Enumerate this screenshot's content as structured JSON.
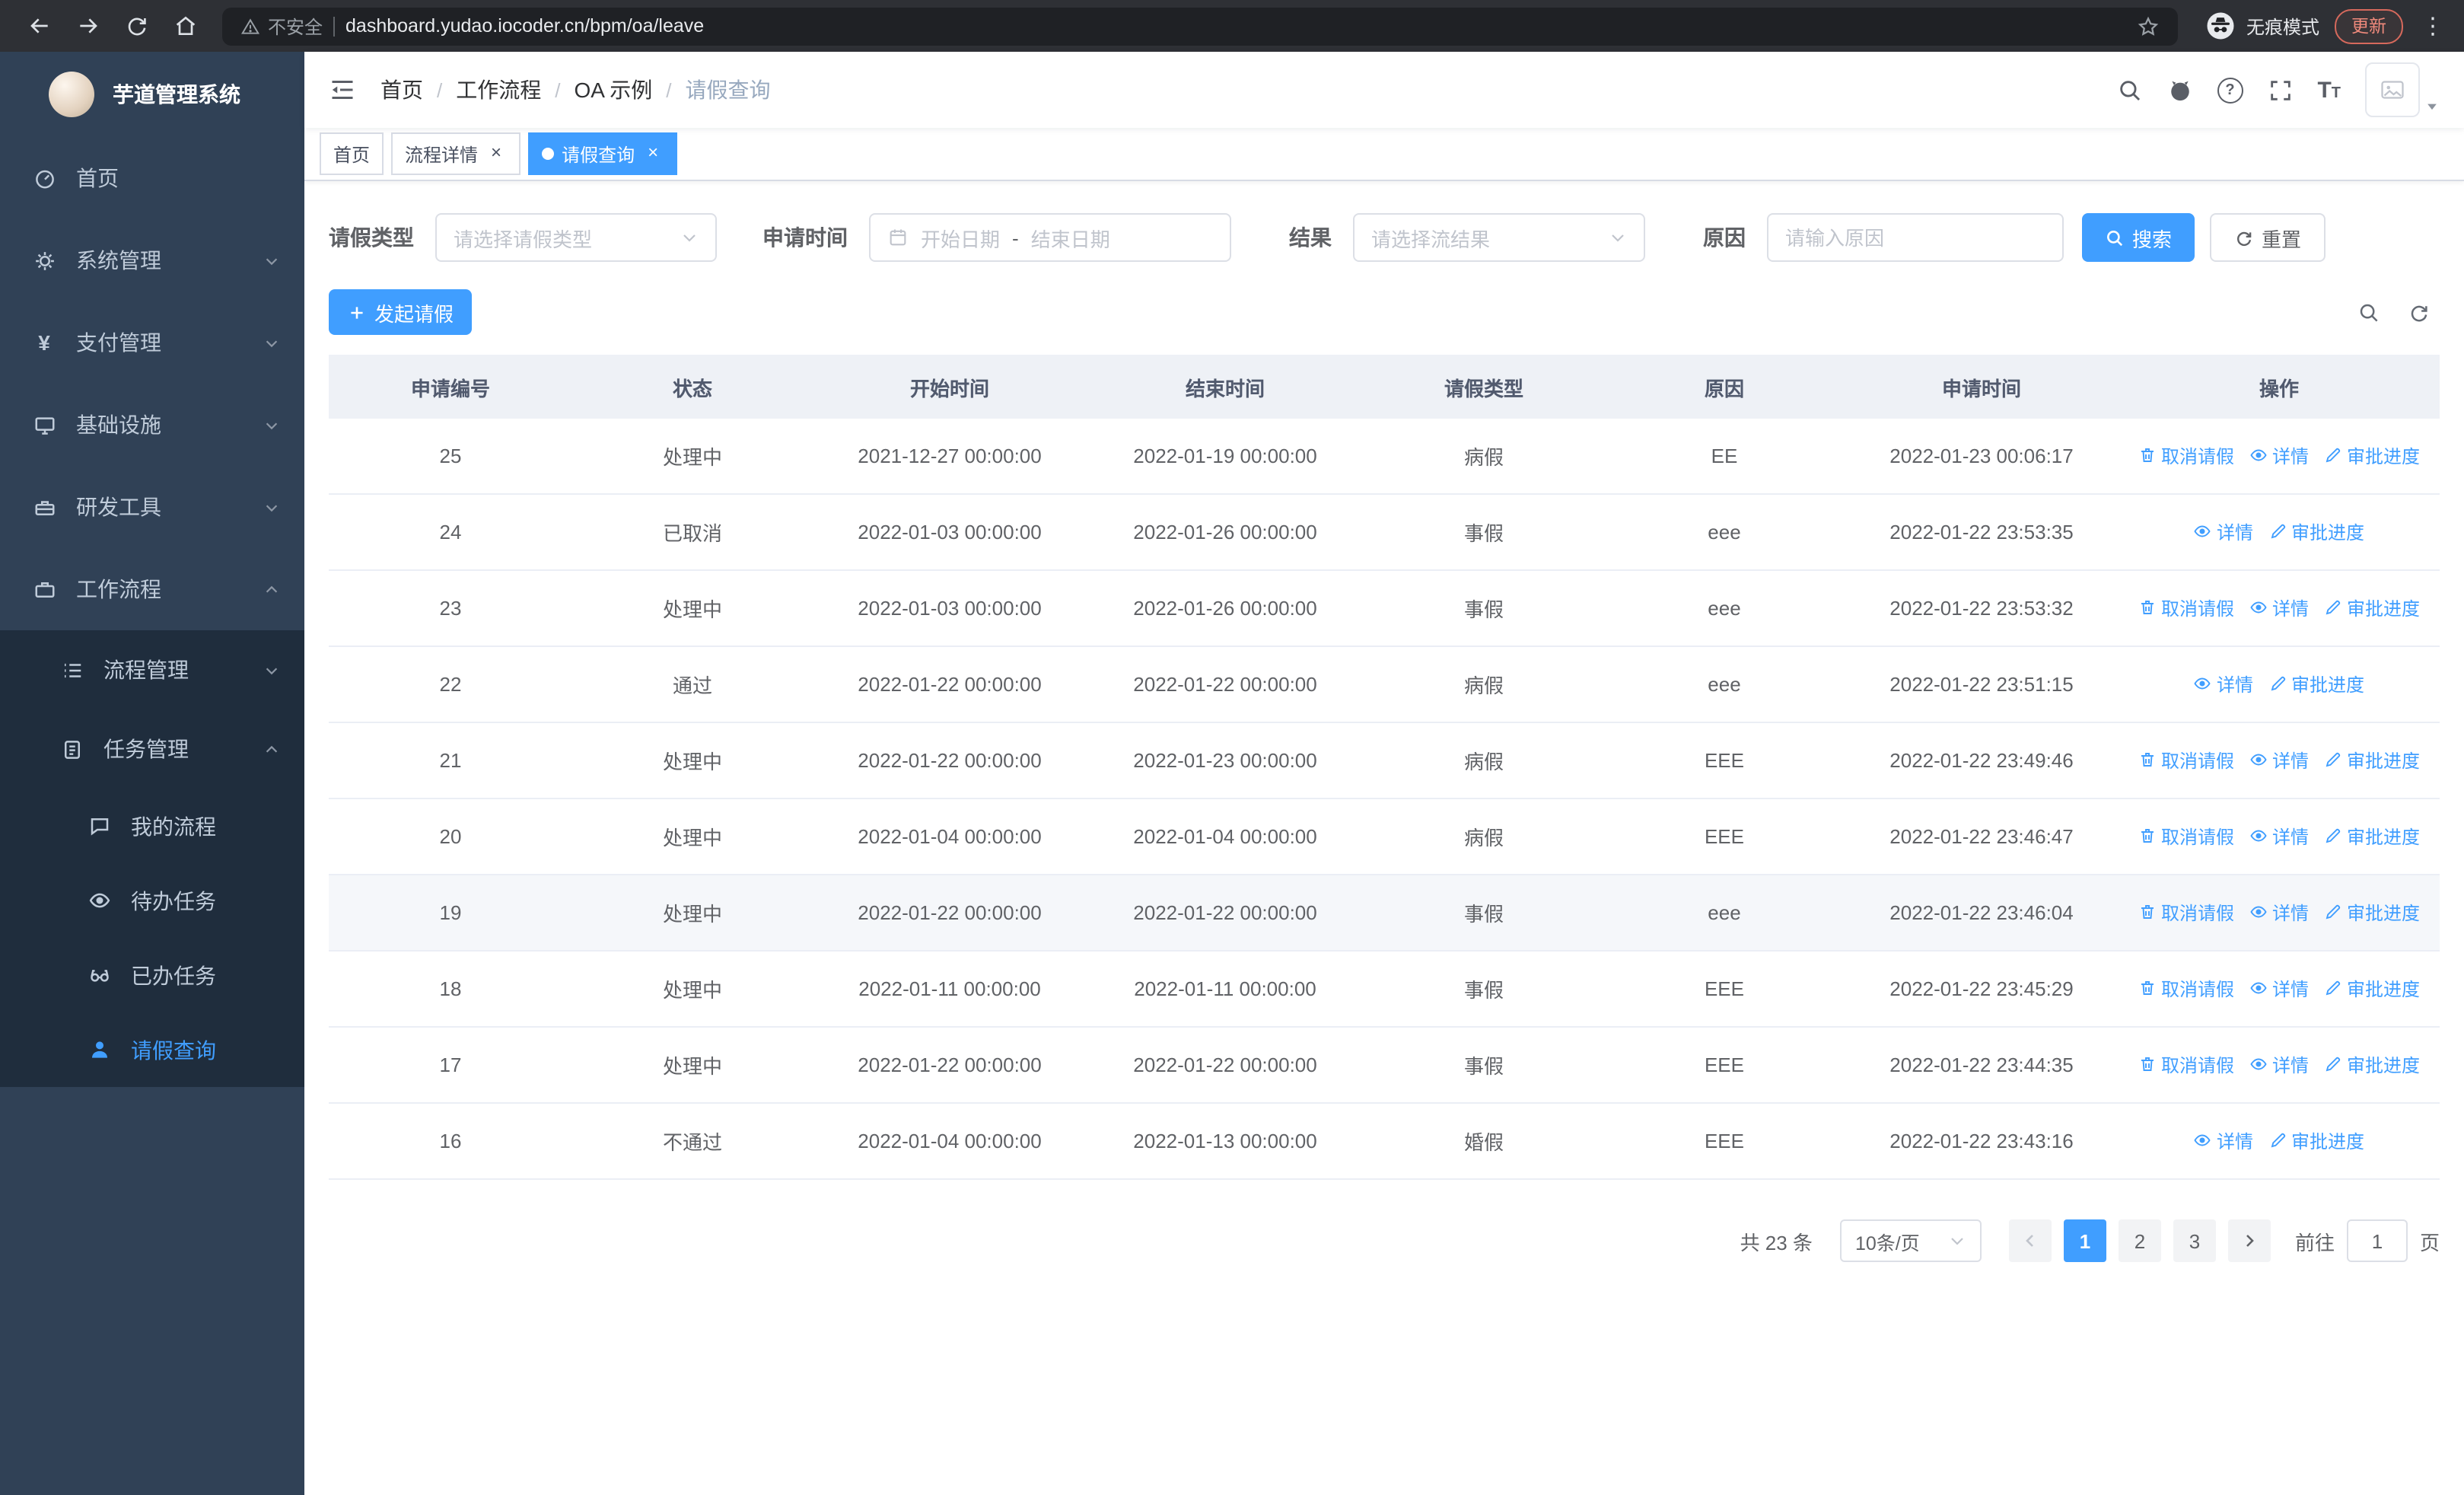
{
  "browser": {
    "security_label": "不安全",
    "url": "dashboard.yudao.iocoder.cn/bpm/oa/leave",
    "incognito_label": "无痕模式",
    "update_label": "更新"
  },
  "sidebar": {
    "logo_title": "芋道管理系统",
    "items": [
      {
        "label": "首页"
      },
      {
        "label": "系统管理"
      },
      {
        "label": "支付管理"
      },
      {
        "label": "基础设施"
      },
      {
        "label": "研发工具"
      },
      {
        "label": "工作流程",
        "children": [
          {
            "label": "流程管理"
          },
          {
            "label": "任务管理",
            "children": [
              {
                "label": "我的流程"
              },
              {
                "label": "待办任务"
              },
              {
                "label": "已办任务"
              },
              {
                "label": "请假查询",
                "active": true
              }
            ]
          }
        ]
      }
    ]
  },
  "header": {
    "breadcrumb": [
      "首页",
      "工作流程",
      "OA 示例",
      "请假查询"
    ]
  },
  "tabs": [
    {
      "label": "首页"
    },
    {
      "label": "流程详情"
    },
    {
      "label": "请假查询"
    }
  ],
  "filters": {
    "leave_type": {
      "label": "请假类型",
      "placeholder": "请选择请假类型"
    },
    "apply_time": {
      "label": "申请时间",
      "start_placeholder": "开始日期",
      "separator": "-",
      "end_placeholder": "结束日期"
    },
    "result": {
      "label": "结果",
      "placeholder": "请选择流结果"
    },
    "reason": {
      "label": "原因",
      "placeholder": "请输入原因"
    },
    "search_label": "搜索",
    "reset_label": "重置"
  },
  "toolbar": {
    "create_label": "发起请假"
  },
  "table": {
    "columns": [
      "申请编号",
      "状态",
      "开始时间",
      "结束时间",
      "请假类型",
      "原因",
      "申请时间",
      "操作"
    ],
    "action_labels": {
      "cancel": "取消请假",
      "detail": "详情",
      "progress": "审批进度"
    },
    "rows": [
      {
        "id": "25",
        "status": "处理中",
        "start": "2021-12-27 00:00:00",
        "end": "2022-01-19 00:00:00",
        "type": "病假",
        "reason": "EE",
        "apply_time": "2022-01-23 00:06:17",
        "actions": [
          "cancel",
          "detail",
          "progress"
        ]
      },
      {
        "id": "24",
        "status": "已取消",
        "start": "2022-01-03 00:00:00",
        "end": "2022-01-26 00:00:00",
        "type": "事假",
        "reason": "eee",
        "apply_time": "2022-01-22 23:53:35",
        "actions": [
          "detail",
          "progress"
        ]
      },
      {
        "id": "23",
        "status": "处理中",
        "start": "2022-01-03 00:00:00",
        "end": "2022-01-26 00:00:00",
        "type": "事假",
        "reason": "eee",
        "apply_time": "2022-01-22 23:53:32",
        "actions": [
          "cancel",
          "detail",
          "progress"
        ]
      },
      {
        "id": "22",
        "status": "通过",
        "start": "2022-01-22 00:00:00",
        "end": "2022-01-22 00:00:00",
        "type": "病假",
        "reason": "eee",
        "apply_time": "2022-01-22 23:51:15",
        "actions": [
          "detail",
          "progress"
        ]
      },
      {
        "id": "21",
        "status": "处理中",
        "start": "2022-01-22 00:00:00",
        "end": "2022-01-23 00:00:00",
        "type": "病假",
        "reason": "EEE",
        "apply_time": "2022-01-22 23:49:46",
        "actions": [
          "cancel",
          "detail",
          "progress"
        ]
      },
      {
        "id": "20",
        "status": "处理中",
        "start": "2022-01-04 00:00:00",
        "end": "2022-01-04 00:00:00",
        "type": "病假",
        "reason": "EEE",
        "apply_time": "2022-01-22 23:46:47",
        "actions": [
          "cancel",
          "detail",
          "progress"
        ]
      },
      {
        "id": "19",
        "status": "处理中",
        "start": "2022-01-22 00:00:00",
        "end": "2022-01-22 00:00:00",
        "type": "事假",
        "reason": "eee",
        "apply_time": "2022-01-22 23:46:04",
        "actions": [
          "cancel",
          "detail",
          "progress"
        ],
        "highlighted": true
      },
      {
        "id": "18",
        "status": "处理中",
        "start": "2022-01-11 00:00:00",
        "end": "2022-01-11 00:00:00",
        "type": "事假",
        "reason": "EEE",
        "apply_time": "2022-01-22 23:45:29",
        "actions": [
          "cancel",
          "detail",
          "progress"
        ]
      },
      {
        "id": "17",
        "status": "处理中",
        "start": "2022-01-22 00:00:00",
        "end": "2022-01-22 00:00:00",
        "type": "事假",
        "reason": "EEE",
        "apply_time": "2022-01-22 23:44:35",
        "actions": [
          "cancel",
          "detail",
          "progress"
        ]
      },
      {
        "id": "16",
        "status": "不通过",
        "start": "2022-01-04 00:00:00",
        "end": "2022-01-13 00:00:00",
        "type": "婚假",
        "reason": "EEE",
        "apply_time": "2022-01-22 23:43:16",
        "actions": [
          "detail",
          "progress"
        ]
      }
    ]
  },
  "pagination": {
    "total_label": "共 23 条",
    "page_size": "10条/页",
    "pages": [
      "1",
      "2",
      "3"
    ],
    "active_page": "1",
    "goto_label": "前往",
    "goto_value": "1",
    "page_label": "页"
  },
  "colors": {
    "primary": "#409eff",
    "sidebar_bg": "#304156",
    "submenu_bg": "#1f2d3d",
    "active_text": "#409eff"
  }
}
